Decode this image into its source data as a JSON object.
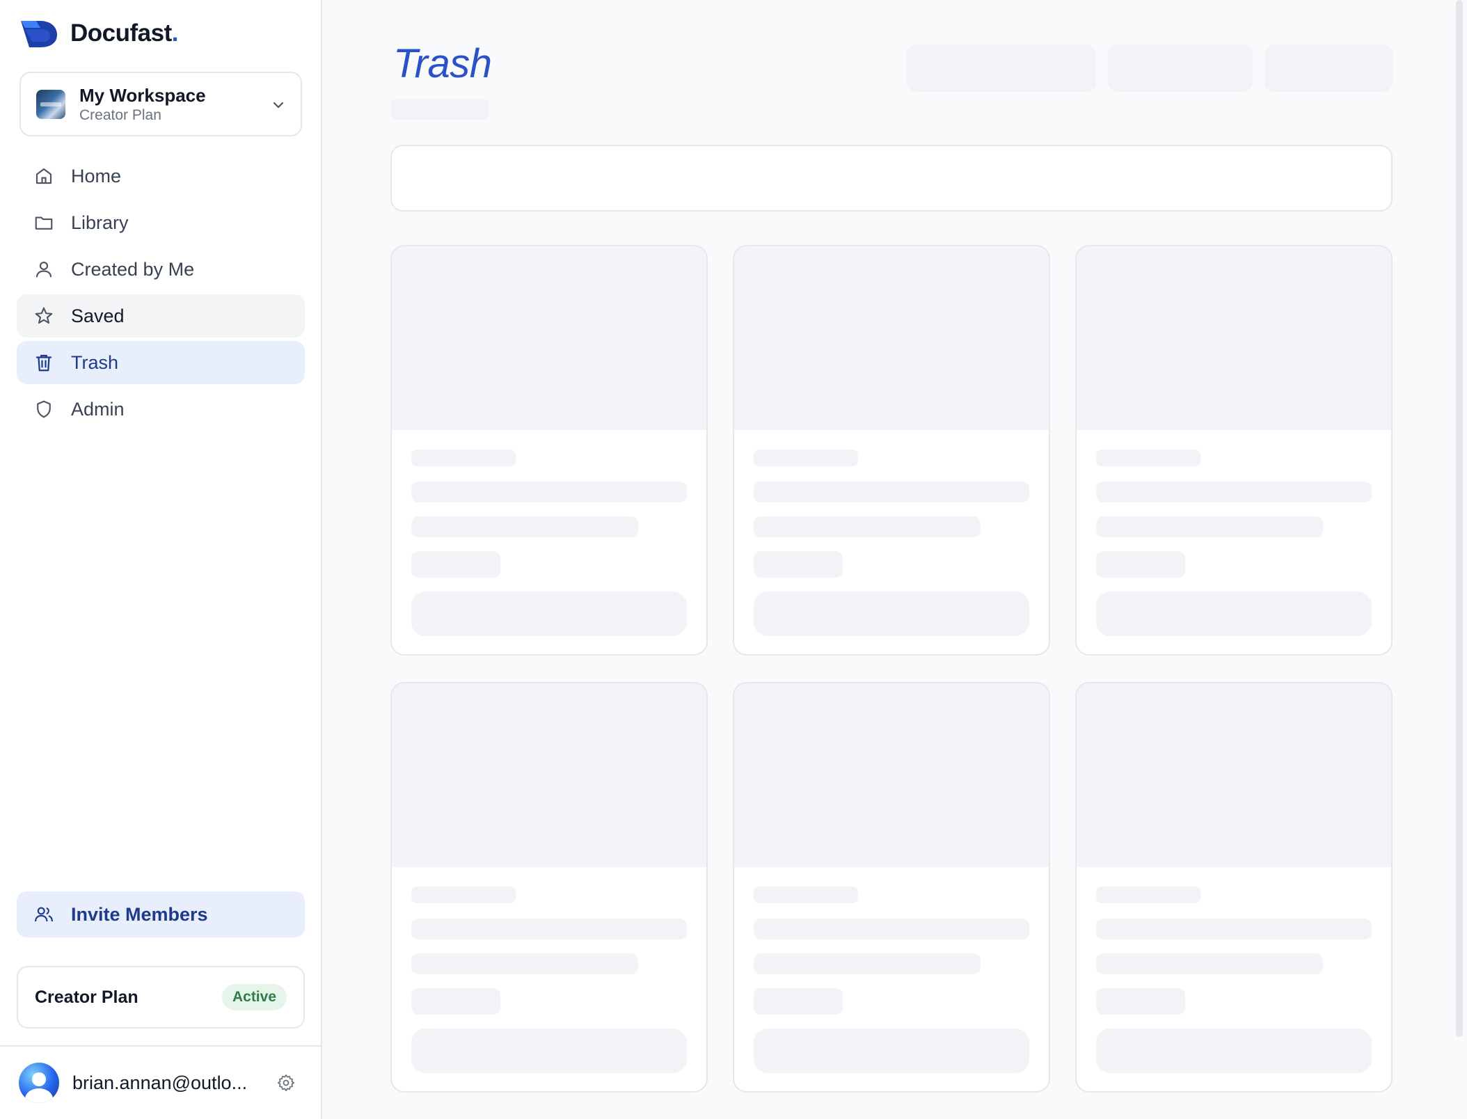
{
  "brand": {
    "name": "Docufast",
    "dot": "."
  },
  "workspace": {
    "name": "My Workspace",
    "plan": "Creator Plan"
  },
  "nav": {
    "items": [
      {
        "label": "Home",
        "icon": "home-icon",
        "state": "default"
      },
      {
        "label": "Library",
        "icon": "folder-icon",
        "state": "default"
      },
      {
        "label": "Created by Me",
        "icon": "user-icon",
        "state": "default"
      },
      {
        "label": "Saved",
        "icon": "star-icon",
        "state": "hover"
      },
      {
        "label": "Trash",
        "icon": "trash-icon",
        "state": "active"
      },
      {
        "label": "Admin",
        "icon": "shield-icon",
        "state": "default"
      }
    ]
  },
  "invite": {
    "label": "Invite Members",
    "icon": "users-icon"
  },
  "plan_card": {
    "title": "Creator Plan",
    "status": "Active"
  },
  "user": {
    "email": "brian.annan@outlo..."
  },
  "page": {
    "title": "Trash"
  },
  "colors": {
    "accent": "#2b51c9",
    "active_bg": "#e8eefb",
    "active_text": "#1e3a8a",
    "badge_bg": "#e6f4ea",
    "badge_text": "#2f7d46",
    "skeleton": "#f1f3f6"
  }
}
